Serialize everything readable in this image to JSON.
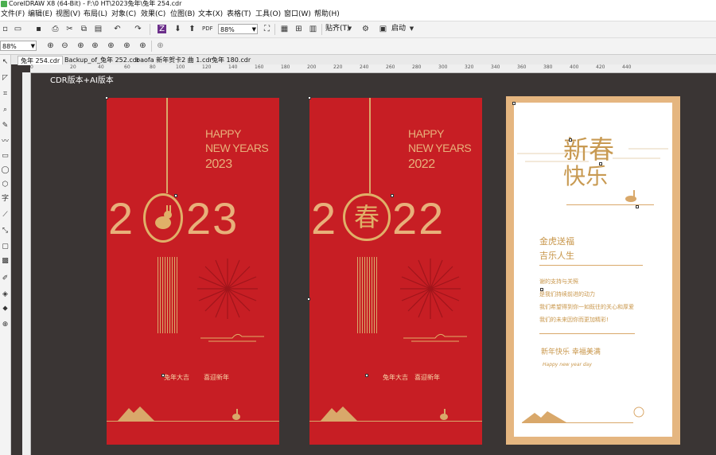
{
  "window": {
    "title": "CorelDRAW X8 (64-Bit) - F:\\0 HT\\2023兔年\\兔年 254.cdr"
  },
  "menu": [
    "文件(F)",
    "编辑(E)",
    "视图(V)",
    "布局(L)",
    "对象(C)",
    "效果(C)",
    "位图(B)",
    "文本(X)",
    "表格(T)",
    "工具(O)",
    "窗口(W)",
    "帮助(H)"
  ],
  "toolbar": {
    "zoom_value": "88%",
    "snap_label": "贴齐(T)",
    "launch_label": "启动",
    "zoom2_value": "88%"
  },
  "tabs": [
    "兔年 254.cdr",
    "Backup_of_兔年 252.cdr",
    "baofa 新年贺卡2 曲 1.cdr",
    "兔年 180.cdr"
  ],
  "ruler_ticks": [
    "0",
    "20",
    "40",
    "60",
    "80",
    "100",
    "120",
    "140",
    "160",
    "180",
    "200",
    "220",
    "240",
    "260",
    "280",
    "300",
    "320",
    "340",
    "360",
    "380",
    "400",
    "420",
    "440"
  ],
  "canvas_label": "CDR版本+AI版本",
  "card1": {
    "happy": "HAPPY",
    "new_years": "NEW YEARS",
    "year_small": "2023",
    "big_left": "2",
    "big_right": "23",
    "blessing_left": "兔年大吉",
    "blessing_right": "喜迎新年"
  },
  "card2": {
    "happy": "HAPPY",
    "new_years": "NEW YEARS",
    "year_small": "2022",
    "big_left": "2",
    "big_center": "春",
    "big_right": "22",
    "blessing_left": "兔年大吉",
    "blessing_right": "喜迎新年"
  },
  "card3": {
    "title_a": "新春",
    "title_b": "快乐",
    "motto_1": "金虎送福",
    "motto_2": "吉乐人生",
    "lines": [
      "谢的支持与关照",
      "是我们持续前进的动力",
      "我们希望得到你一如既往的关心和厚爱",
      "我们的未来因你而更加精彩!"
    ],
    "sign": "新年快乐  幸福美满",
    "script": "Happy new year day"
  },
  "colors": {
    "card_red": "#c71e24",
    "gold": "#e0b068",
    "canvas_bg": "#3a3534"
  }
}
